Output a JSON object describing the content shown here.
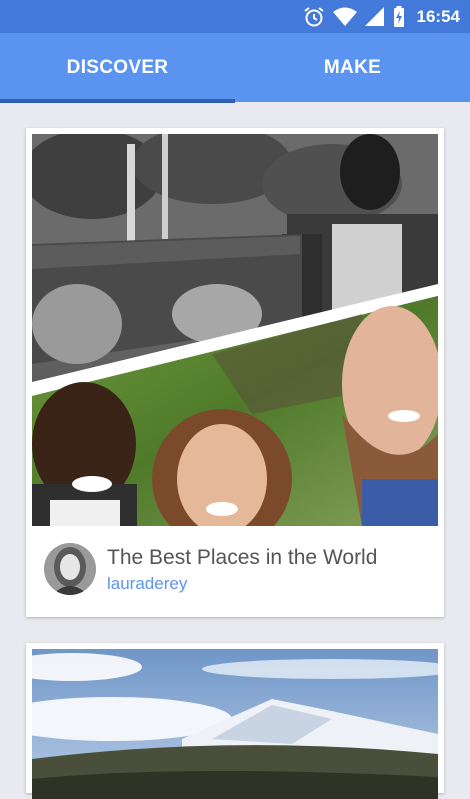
{
  "status_bar": {
    "time": "16:54",
    "icons": [
      "alarm-icon",
      "wifi-icon",
      "signal-icon",
      "battery-charging-icon"
    ]
  },
  "tabs": [
    {
      "label": "DISCOVER",
      "selected": true
    },
    {
      "label": "MAKE",
      "selected": false
    }
  ],
  "cards": [
    {
      "title": "The Best Places in the World",
      "author": "lauraderey"
    }
  ],
  "colors": {
    "status_bar": "#4379d8",
    "app_bar": "#5b94f0",
    "tab_indicator": "#2e5fb4",
    "author_link": "#5b94f0",
    "background": "#e9eaef"
  }
}
